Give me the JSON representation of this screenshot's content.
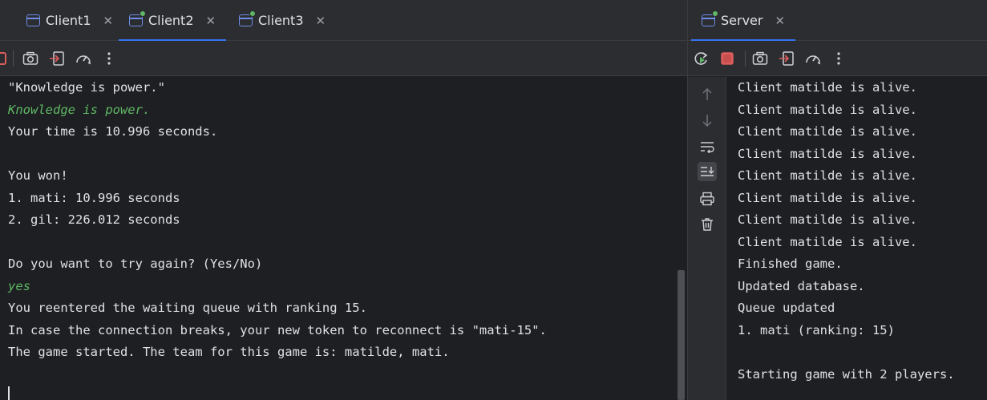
{
  "left": {
    "tabs": [
      {
        "label": "Client1",
        "active": false,
        "running": false
      },
      {
        "label": "Client2",
        "active": true,
        "running": true
      },
      {
        "label": "Client3",
        "active": false,
        "running": true
      }
    ],
    "console_lines": [
      {
        "text": "\"Knowledge is power.\"",
        "kind": "output"
      },
      {
        "text": "Knowledge is power.",
        "kind": "input"
      },
      {
        "text": "Your time is 10.996 seconds.",
        "kind": "output"
      },
      {
        "text": "",
        "kind": "output"
      },
      {
        "text": "You won!",
        "kind": "output"
      },
      {
        "text": "1. mati: 10.996 seconds",
        "kind": "output"
      },
      {
        "text": "2. gil: 226.012 seconds",
        "kind": "output"
      },
      {
        "text": "",
        "kind": "output"
      },
      {
        "text": "Do you want to try again? (Yes/No)",
        "kind": "output"
      },
      {
        "text": "yes",
        "kind": "input"
      },
      {
        "text": "You reentered the waiting queue with ranking 15.",
        "kind": "output"
      },
      {
        "text": "In case the connection breaks, your new token to reconnect is \"mati-15\".",
        "kind": "output"
      },
      {
        "text": "The game started. The team for this game is: matilde, mati.",
        "kind": "output"
      }
    ]
  },
  "right": {
    "tabs": [
      {
        "label": "Server",
        "active": true,
        "running": true
      }
    ],
    "console_lines": [
      {
        "text": "Client matilde is alive.",
        "kind": "output"
      },
      {
        "text": "Client matilde is alive.",
        "kind": "output"
      },
      {
        "text": "Client matilde is alive.",
        "kind": "output"
      },
      {
        "text": "Client matilde is alive.",
        "kind": "output"
      },
      {
        "text": "Client matilde is alive.",
        "kind": "output"
      },
      {
        "text": "Client matilde is alive.",
        "kind": "output"
      },
      {
        "text": "Client matilde is alive.",
        "kind": "output"
      },
      {
        "text": "Client matilde is alive.",
        "kind": "output"
      },
      {
        "text": "Finished game.",
        "kind": "output"
      },
      {
        "text": "Updated database.",
        "kind": "output"
      },
      {
        "text": "Queue updated",
        "kind": "output"
      },
      {
        "text": "1. mati (ranking: 15)",
        "kind": "output"
      },
      {
        "text": "",
        "kind": "output"
      },
      {
        "text": "Starting game with 2 players.",
        "kind": "output"
      }
    ]
  },
  "icons": {
    "toolbar_left": [
      "stop-icon",
      "camera-icon",
      "exit-icon",
      "speedometer-icon",
      "more-vertical-icon"
    ],
    "toolbar_right": [
      "rerun-icon",
      "stop-icon",
      "camera-icon",
      "exit-icon",
      "speedometer-icon",
      "more-vertical-icon"
    ],
    "console_sidebar": [
      "arrow-up-icon",
      "arrow-down-icon",
      "soft-wrap-icon",
      "scroll-to-end-icon",
      "print-icon",
      "trash-icon"
    ]
  },
  "colors": {
    "background": "#1e1f22",
    "panel": "#2b2d30",
    "text": "#dfe1e5",
    "input_text": "#5fb865",
    "accent": "#3574f0",
    "stop_red": "#db5c5c",
    "run_green": "#5fb865"
  }
}
